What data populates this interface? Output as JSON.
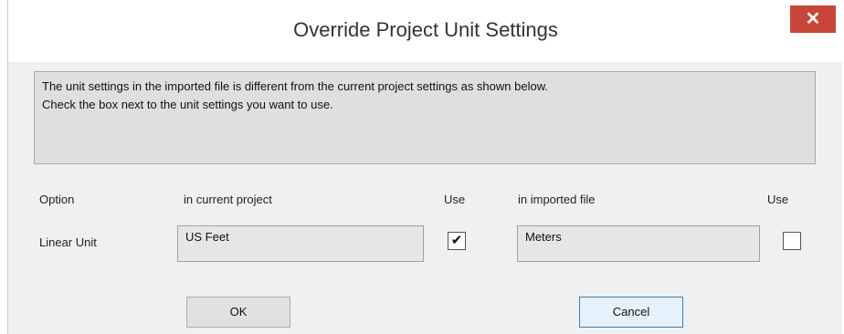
{
  "dialog": {
    "title": "Override Project Unit Settings",
    "close_glyph": "✕"
  },
  "message": {
    "line1": "The unit settings in the imported file is different from the current project settings as shown below.",
    "line2": "Check the box next to the unit settings you want to use."
  },
  "columns": {
    "option": "Option",
    "current": "in current project",
    "use_current": "Use",
    "imported": "in imported file",
    "use_imported": "Use"
  },
  "row": {
    "label": "Linear Unit",
    "current_value": "US Feet",
    "current_checked": true,
    "imported_value": "Meters",
    "imported_checked": false,
    "check_glyph": "✔"
  },
  "buttons": {
    "ok": "OK",
    "cancel": "Cancel"
  },
  "colors": {
    "close_button": "#c8453a",
    "dialog_bg": "#f0f0f0",
    "message_bg": "#dfdfdf"
  },
  "icons": {
    "close": "close-icon",
    "check": "checkmark-icon"
  }
}
